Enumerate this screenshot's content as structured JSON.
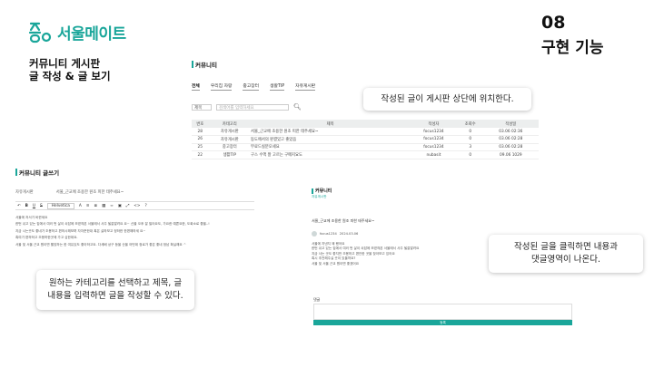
{
  "logo": {
    "name": "서울메이트"
  },
  "headline": {
    "line1": "커뮤니티 게시판",
    "line2": "글 작성 & 글 보기"
  },
  "section": {
    "number": "08",
    "title": "구현 기능"
  },
  "board": {
    "title": "커뮤니티",
    "tabs": [
      "전체",
      "우리집 자랑",
      "중고장터",
      "생활TIP",
      "자유게시판"
    ],
    "search": {
      "select": "제목",
      "placeholder": "검색어를 입력하세요"
    },
    "columns": [
      "번호",
      "카테고리",
      "제목",
      "작성자",
      "조회수",
      "작성일"
    ],
    "rows": [
      [
        "28",
        "자유게시판",
        "서울_근교에 조용한 원조 피한 테주세요~",
        "focus1234",
        "0",
        "03.06 02:36"
      ],
      [
        "26",
        "자유게시판",
        "동도에서의 판결있고 좋았음",
        "focus1234",
        "0",
        "03.06 02:28"
      ],
      [
        "25",
        "중고장터",
        "무료드실분오세요",
        "focus1234",
        "3",
        "03.06 02:28"
      ],
      [
        "22",
        "생활TIP",
        "구스 수액 잘 고르는 구매지요도",
        "nubasit",
        "0",
        "09.06 1029"
      ]
    ]
  },
  "write": {
    "title": "커뮤니티 글쓰기",
    "category": "자유게시판",
    "subject": "서울_근교에 조용한 원조 피한 테주세요~",
    "font_select": "Helvetica",
    "body_lines": [
      "서울에 저서가 바뀐세요",
      "한번 쉬고 있는 집에서 여러 번 살이 쇠잡에 모였혀본 서울에서 사주 될잘알려요 요~ 산을 오후 잘 빌어요도, 가요한 예쁜요한, 도회소로 좋을..!",
      "지금 시는곳도 좋네가 조용하고 편하시해보며 자자준한대 혹은 살하보고 정하한 한편해하세 요~",
      "혹여가 편하하고 조용하한곳에 가고 싶한데요.",
      "서울 및 서울 근교 원이면 빨았하는 한 여유있도 좋아하고요. 다세배 상구 등을 산을 어떤데 정로가 좋은 좋네 정남 확실해요 ^"
    ]
  },
  "detail": {
    "title_label": "커뮤니티",
    "tag": "자유게시판",
    "post_title": "서울_근교에 조용한 원조 피한 테주세요~",
    "author": "focus1234",
    "date": "2024.03.06",
    "body_lines": [
      "서울에 지낸지 꽤 됐어요",
      "한번 쉬고 있는 집에서 여러 번 살이 쇠잡에 모였혀본 서울에서 사주 될잘알려요",
      "지금 사는 곳도 좋지만 조용하고 편안한 곳을 찾아보고 있어요",
      "혹시 추천해주실 곳이 있을까요?",
      "서울 및 서울 근교 원이면 좋겠어요"
    ],
    "comment_label": "댓글",
    "comment_button": "등록"
  },
  "callouts": {
    "top": "작성된 글이 게시판 상단에 위치한다.",
    "right_line1": "작성된 글을 클릭하면 내용과",
    "right_line2": "댓글영역이 나온다.",
    "left_line1": "원하는 카테고리를 선택하고 제목, 글",
    "left_line2": "내용을 입력하면 글을 작성할 수 있다."
  },
  "colors": {
    "brand": "#1aa69a",
    "highlight": "#f7ec2e"
  }
}
